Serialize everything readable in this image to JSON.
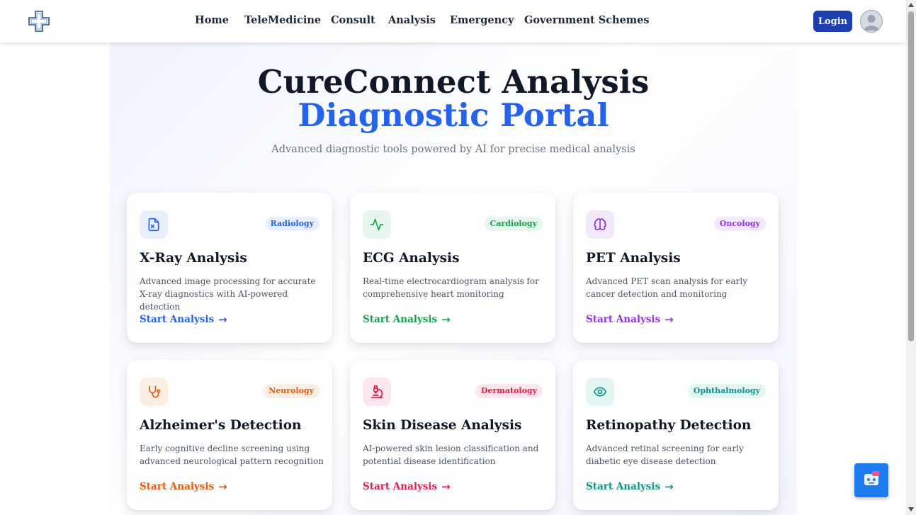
{
  "nav": {
    "items": [
      "Home",
      "TeleMedicine",
      "Consult",
      "Analysis",
      "Emergency",
      "Government Schemes"
    ],
    "login_label": "Login"
  },
  "hero": {
    "title": "CureConnect Analysis",
    "subtitle": "Diagnostic Portal",
    "description": "Advanced diagnostic tools powered by AI for precise medical analysis"
  },
  "cards": [
    {
      "title": "X-Ray Analysis",
      "badge": "Radiology",
      "description": "Advanced image processing for accurate X-ray diagnostics with AI-powered detection",
      "cta": "Start Analysis",
      "color": "#2563eb",
      "badge_bg": "#e8efff",
      "icon_bg": "#e8efff",
      "icon": "xray-file-icon"
    },
    {
      "title": "ECG Analysis",
      "badge": "Cardiology",
      "description": "Real-time electrocardiogram analysis for comprehensive heart monitoring",
      "cta": "Start Analysis",
      "color": "#16a34a",
      "badge_bg": "#e6f6ec",
      "icon_bg": "#e6f6ec",
      "icon": "heartbeat-icon"
    },
    {
      "title": "PET Analysis",
      "badge": "Oncology",
      "description": "Advanced PET scan analysis for early cancer detection and monitoring",
      "cta": "Start Analysis",
      "color": "#9333ea",
      "badge_bg": "#f3e9fd",
      "icon_bg": "#f3e9fd",
      "icon": "brain-icon"
    },
    {
      "title": "Alzheimer's Detection",
      "badge": "Neurology",
      "description": "Early cognitive decline screening using advanced neurological pattern recognition",
      "cta": "Start Analysis",
      "color": "#ea580c",
      "badge_bg": "#fdeee4",
      "icon_bg": "#fdeee4",
      "icon": "stethoscope-icon"
    },
    {
      "title": "Skin Disease Analysis",
      "badge": "Dermatology",
      "description": "AI-powered skin lesion classification and potential disease identification",
      "cta": "Start Analysis",
      "color": "#e11d48",
      "badge_bg": "#fde7ec",
      "icon_bg": "#fde7ec",
      "icon": "microscope-icon"
    },
    {
      "title": "Retinopathy Detection",
      "badge": "Ophthalmology",
      "description": "Advanced retinal screening for early diabetic eye disease detection",
      "cta": "Start Analysis",
      "color": "#0d9488",
      "badge_bg": "#e3f6f3",
      "icon_bg": "#e3f6f3",
      "icon": "eye-icon"
    }
  ]
}
